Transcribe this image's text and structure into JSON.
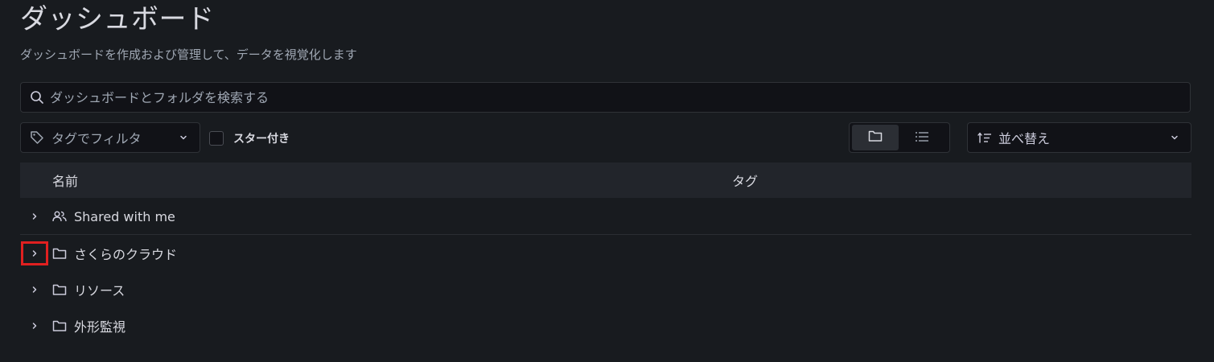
{
  "header": {
    "title": "ダッシュボード",
    "subtitle": "ダッシュボードを作成および管理して、データを視覚化します"
  },
  "search": {
    "placeholder": "ダッシュボードとフォルダを検索する",
    "value": ""
  },
  "filters": {
    "tag_filter_label": "タグでフィルタ",
    "starred_label": "スター付き",
    "starred_checked": false,
    "view_mode": "folder",
    "sort_label": "並べ替え"
  },
  "table": {
    "columns": [
      "名前",
      "タグ"
    ],
    "rows": [
      {
        "name": "Shared with me",
        "icon": "users-icon"
      },
      {
        "name": "さくらのクラウド",
        "icon": "folder-icon"
      },
      {
        "name": "リソース",
        "icon": "folder-icon"
      },
      {
        "name": "外形監視",
        "icon": "folder-icon"
      }
    ]
  },
  "colors": {
    "background": "#181b1f",
    "header_row": "#22252b",
    "highlight": "#e02020"
  }
}
